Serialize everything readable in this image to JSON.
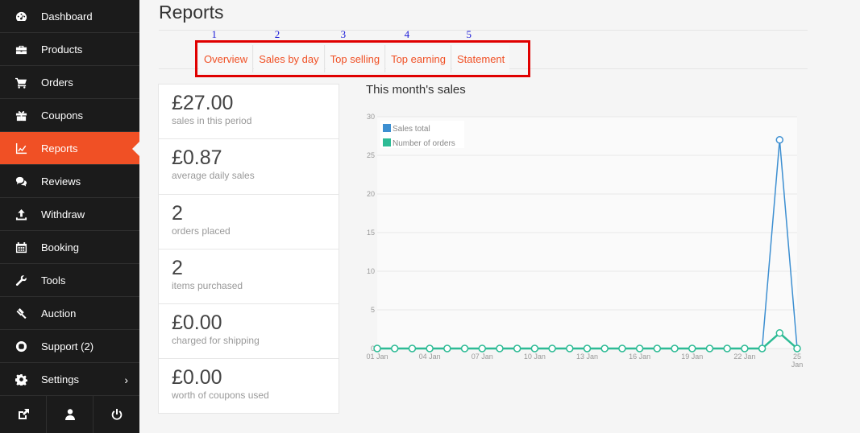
{
  "sidebar": {
    "items": [
      {
        "label": "Dashboard",
        "icon": "dashboard-icon"
      },
      {
        "label": "Products",
        "icon": "briefcase-icon"
      },
      {
        "label": "Orders",
        "icon": "cart-icon"
      },
      {
        "label": "Coupons",
        "icon": "gift-icon"
      },
      {
        "label": "Reports",
        "icon": "line-chart-icon",
        "active": true
      },
      {
        "label": "Reviews",
        "icon": "comments-icon"
      },
      {
        "label": "Withdraw",
        "icon": "upload-icon"
      },
      {
        "label": "Booking",
        "icon": "calendar-icon"
      },
      {
        "label": "Tools",
        "icon": "wrench-icon"
      },
      {
        "label": "Auction",
        "icon": "gavel-icon"
      },
      {
        "label": "Support (2)",
        "icon": "lifebuoy-icon"
      },
      {
        "label": "Settings",
        "icon": "cog-icon",
        "chevron": "›"
      }
    ],
    "bottom": [
      "external-link-icon",
      "user-icon",
      "power-icon"
    ]
  },
  "page": {
    "title": "Reports"
  },
  "tabs": [
    {
      "label": "Overview",
      "num": "1"
    },
    {
      "label": "Sales by day",
      "num": "2"
    },
    {
      "label": "Top selling",
      "num": "3"
    },
    {
      "label": "Top earning",
      "num": "4"
    },
    {
      "label": "Statement",
      "num": "5"
    }
  ],
  "stats": [
    {
      "value": "£27.00",
      "label": "sales in this period"
    },
    {
      "value": "£0.87",
      "label": "average daily sales"
    },
    {
      "value": "2",
      "label": "orders placed"
    },
    {
      "value": "2",
      "label": "items purchased"
    },
    {
      "value": "£0.00",
      "label": "charged for shipping"
    },
    {
      "value": "£0.00",
      "label": "worth of coupons used"
    }
  ],
  "colors": {
    "accent": "#f05025",
    "sidebar_bg": "#1b1b1b",
    "highlight_box": "#e00000",
    "annotation_numbers": "#1a1ad8",
    "series_sales": "#3d8fd1",
    "series_orders": "#2dbb95"
  },
  "chart_data": {
    "type": "line",
    "title": "This month's sales",
    "x": [
      "01 Jan",
      "02 Jan",
      "03 Jan",
      "04 Jan",
      "05 Jan",
      "06 Jan",
      "07 Jan",
      "08 Jan",
      "09 Jan",
      "10 Jan",
      "11 Jan",
      "12 Jan",
      "13 Jan",
      "14 Jan",
      "15 Jan",
      "16 Jan",
      "17 Jan",
      "18 Jan",
      "19 Jan",
      "20 Jan",
      "21 Jan",
      "22 Jan",
      "23 Jan",
      "24 Jan",
      "25 Jan"
    ],
    "x_tick_labels": [
      "01 Jan",
      "04 Jan",
      "07 Jan",
      "10 Jan",
      "13 Jan",
      "16 Jan",
      "19 Jan",
      "22 Jan",
      "25 Jan"
    ],
    "series": [
      {
        "name": "Sales total",
        "color": "#3d8fd1",
        "values": [
          0,
          0,
          0,
          0,
          0,
          0,
          0,
          0,
          0,
          0,
          0,
          0,
          0,
          0,
          0,
          0,
          0,
          0,
          0,
          0,
          0,
          0,
          0,
          27,
          0
        ],
        "markers": "last-only"
      },
      {
        "name": "Number of orders",
        "color": "#2dbb95",
        "values": [
          0,
          0,
          0,
          0,
          0,
          0,
          0,
          0,
          0,
          0,
          0,
          0,
          0,
          0,
          0,
          0,
          0,
          0,
          0,
          0,
          0,
          0,
          0,
          2,
          0
        ],
        "markers": "all"
      }
    ],
    "ylim": [
      0,
      30
    ],
    "y_ticks": [
      0,
      5,
      10,
      15,
      20,
      25,
      30
    ],
    "grid": true,
    "legend": "top-left"
  }
}
